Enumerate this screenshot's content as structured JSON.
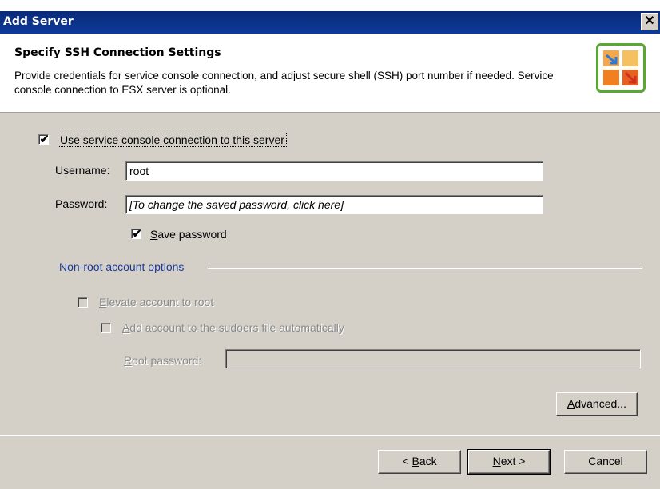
{
  "window": {
    "title": "Add Server",
    "close_glyph": "✕"
  },
  "header": {
    "title": "Specify SSH Connection Settings",
    "description": "Provide credentials for service console connection, and adjust secure shell (SSH) port number if needed. Service console connection to ESX server is optional.",
    "logo_icon": "wizard-logo-icon"
  },
  "form": {
    "use_console": {
      "label": "Use service console connection to this server",
      "checked": true
    },
    "username": {
      "label": "Username:",
      "value": "root"
    },
    "password": {
      "label": "Password:",
      "value": "[To change the saved password, click here]"
    },
    "save_password": {
      "label_accel": "S",
      "label_rest": "ave password",
      "checked": true
    }
  },
  "nonroot": {
    "group_label": "Non-root account options",
    "elevate": {
      "label_accel": "E",
      "label_rest": "levate account to root",
      "checked": false,
      "enabled": false
    },
    "sudoers": {
      "label_accel": "A",
      "label_rest": "dd account to the sudoers file automatically",
      "checked": false,
      "enabled": false
    },
    "root_password": {
      "label_accel": "R",
      "label_rest": "oot password:",
      "value": "",
      "enabled": false
    }
  },
  "buttons": {
    "advanced": {
      "accel": "A",
      "rest": "dvanced..."
    },
    "back": {
      "prefix": "< ",
      "accel": "B",
      "rest": "ack"
    },
    "next": {
      "accel": "N",
      "rest": "ext >"
    },
    "cancel": "Cancel"
  },
  "colors": {
    "titlebar": "#0a2a78",
    "dialog_bg": "#d4d0c8",
    "group_label": "#1a3a9a",
    "logo_border": "#5aa832",
    "logo_orange": "#f08020",
    "logo_blue": "#2a7ad8"
  },
  "check_glyph": "✔"
}
